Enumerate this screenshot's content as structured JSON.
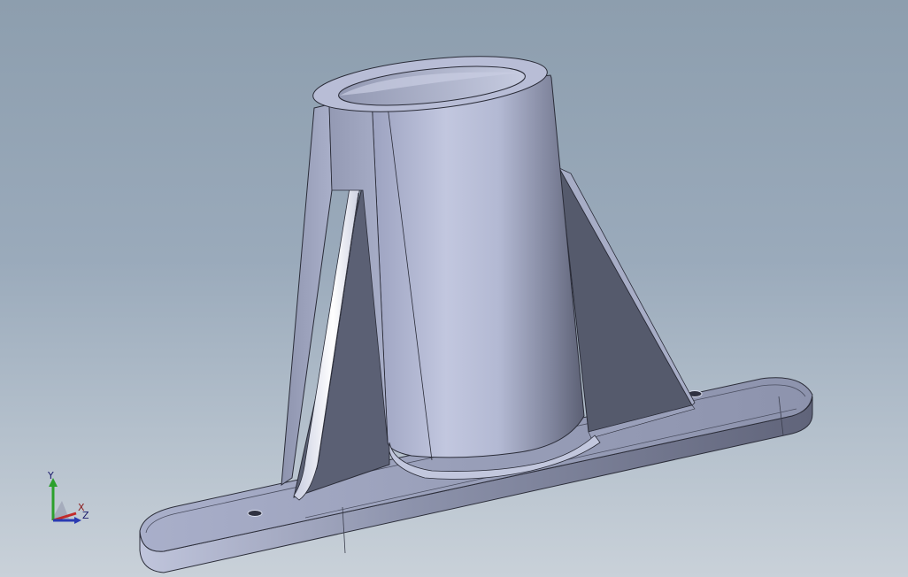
{
  "viewport": {
    "background_top": "#8d9eae",
    "background_bottom": "#c9d1d9",
    "model_color": "#aeb4cd"
  },
  "part": {
    "name": "bracket-with-tube-boss",
    "features": [
      "base-plate",
      "tube-boss",
      "left-gusset",
      "right-gusset",
      "mount-hole-left",
      "mount-hole-right"
    ]
  },
  "triad": {
    "x_label": "X",
    "y_label": "Y",
    "z_label": "Z",
    "x_color": "#c22a2a",
    "y_color": "#2ca02c",
    "z_color": "#2a3ab2"
  }
}
